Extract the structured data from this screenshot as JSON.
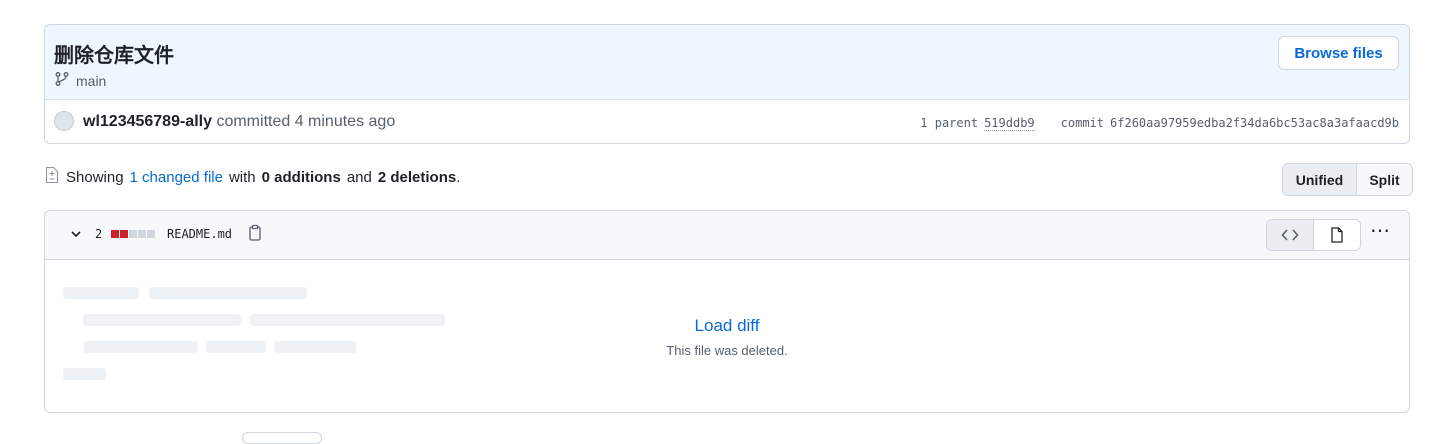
{
  "commit": {
    "title": "删除仓库文件",
    "branch": "main",
    "browse_label": "Browse files",
    "author": "wl123456789-ally",
    "committed_text": "committed",
    "time": "4 minutes ago",
    "parent_label": "1 parent",
    "parent_sha": "519ddb9",
    "commit_label": "commit",
    "commit_sha": "6f260aa97959edba2f34da6bc53ac8a3afaacd9b"
  },
  "stats": {
    "showing": "Showing",
    "changed_link": "1 changed file",
    "with": "with",
    "additions": "0 additions",
    "and": "and",
    "deletions": "2 deletions",
    "period": "."
  },
  "view_toggle": {
    "unified": "Unified",
    "split": "Split",
    "selected": "Unified"
  },
  "file": {
    "changes": "2",
    "diffstat": [
      "deleted",
      "deleted",
      "neutral",
      "neutral",
      "neutral"
    ],
    "name": "README.md",
    "load_diff": "Load diff",
    "note": "This file was deleted."
  },
  "colors": {
    "accent": "#0969da",
    "deleted": "#cf222e",
    "neutral": "#d0d7de",
    "header_bg": "#eef6ff"
  },
  "icons": [
    "git-branch-icon",
    "avatar",
    "file-diff-icon",
    "chevron-down-icon",
    "copy-icon",
    "code-icon",
    "file-icon",
    "kebab-icon"
  ]
}
